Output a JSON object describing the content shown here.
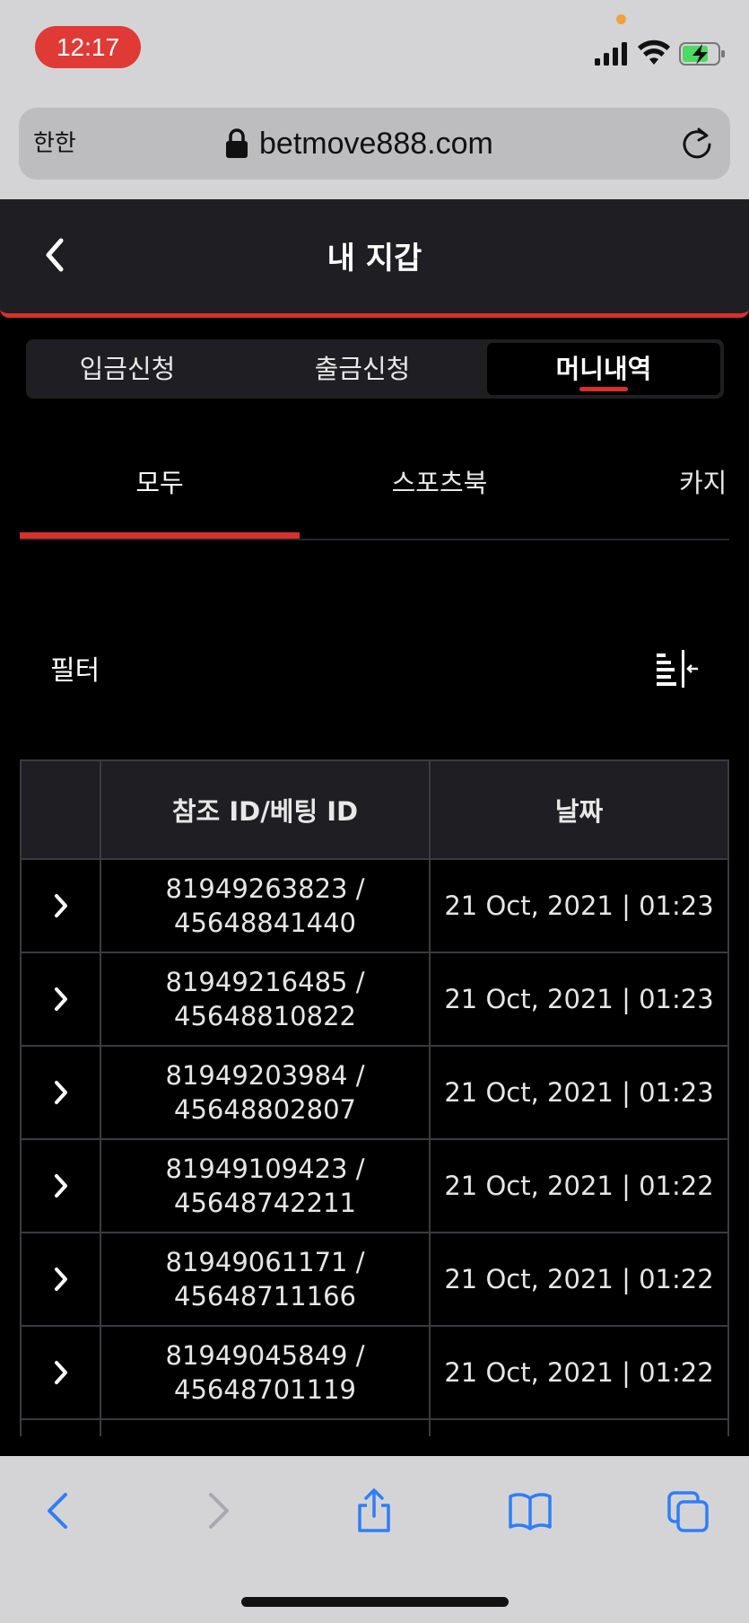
{
  "status_bar": {
    "time": "12:17"
  },
  "browser": {
    "aa_label": "한한",
    "url": "betmove888.com"
  },
  "header": {
    "title": "내 지갑"
  },
  "main_tabs": [
    {
      "label": "입금신청"
    },
    {
      "label": "출금신청"
    },
    {
      "label": "머니내역"
    }
  ],
  "sub_tabs": [
    {
      "label": "모두"
    },
    {
      "label": "스포츠북"
    },
    {
      "label": "카지"
    }
  ],
  "filter": {
    "label": "필터"
  },
  "table": {
    "headers": [
      "",
      "참조 ID/베팅 ID",
      "날짜"
    ],
    "rows": [
      {
        "ref_line1": "81949263823 /",
        "ref_line2": "45648841440",
        "date": "21 Oct, 2021 | 01:23"
      },
      {
        "ref_line1": "81949216485 /",
        "ref_line2": "45648810822",
        "date": "21 Oct, 2021 | 01:23"
      },
      {
        "ref_line1": "81949203984 /",
        "ref_line2": "45648802807",
        "date": "21 Oct, 2021 | 01:23"
      },
      {
        "ref_line1": "81949109423 /",
        "ref_line2": "45648742211",
        "date": "21 Oct, 2021 | 01:22"
      },
      {
        "ref_line1": "81949061171 /",
        "ref_line2": "45648711166",
        "date": "21 Oct, 2021 | 01:22"
      },
      {
        "ref_line1": "81949045849 /",
        "ref_line2": "45648701119",
        "date": "21 Oct, 2021 | 01:22"
      }
    ]
  },
  "colors": {
    "accent": "#d6312b",
    "surface": "#1f1f23",
    "background": "#000000",
    "ios_link": "#2f7ef6"
  }
}
